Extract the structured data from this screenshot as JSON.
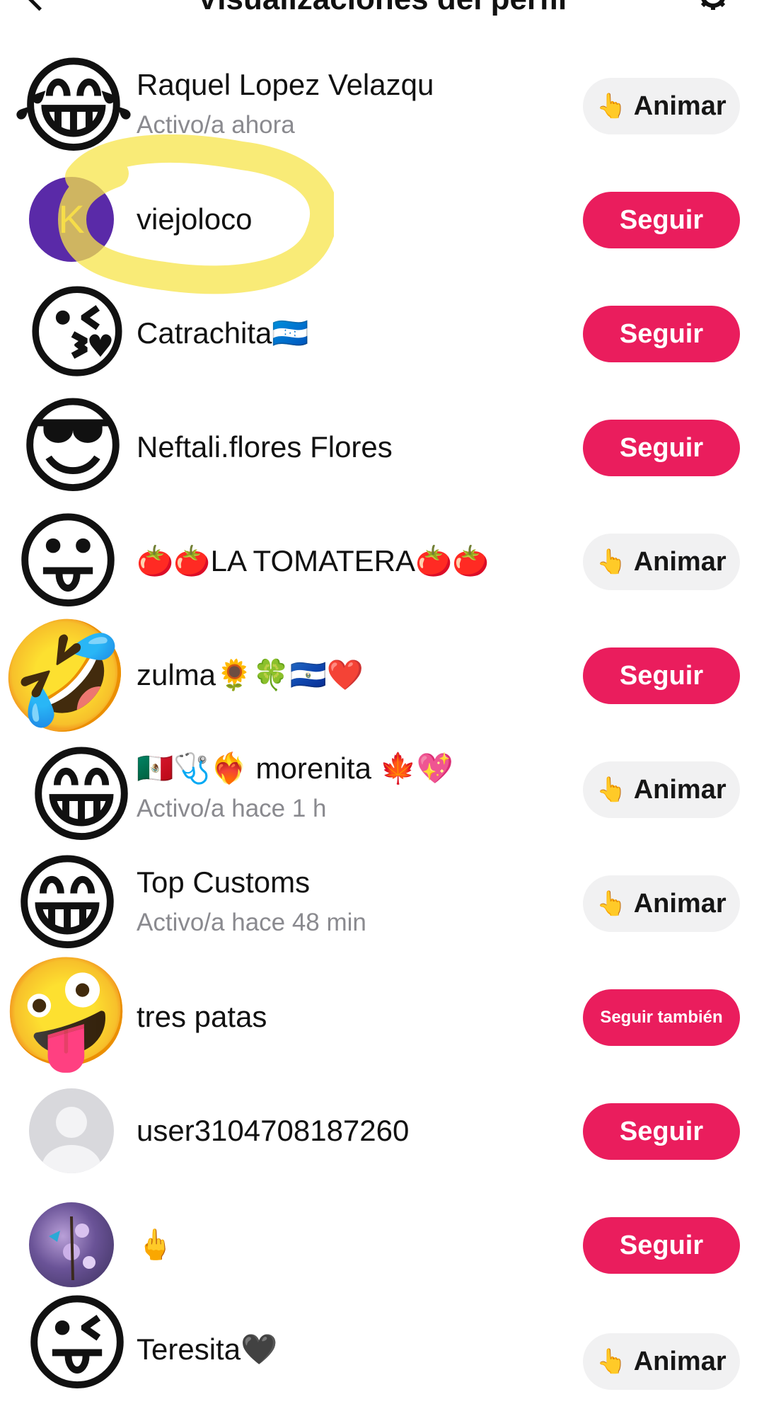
{
  "header": {
    "title": "Visualizaciones del perfil"
  },
  "rows": [
    {
      "name": "Raquel Lopez Velazqu",
      "status": "Activo/a ahora",
      "avatar": "😂",
      "button": "Animar",
      "button_icon": "👆"
    },
    {
      "name": "viejoloco",
      "avatar": "K",
      "button": "Seguir"
    },
    {
      "name": "Catrachita🇭🇳",
      "avatar": "😘",
      "button": "Seguir"
    },
    {
      "name": "Neftali.flores Flores",
      "avatar": "😎",
      "button": "Seguir"
    },
    {
      "name": "🍅🍅LA TOMATERA🍅🍅",
      "avatar": "😛",
      "button": "Animar",
      "button_icon": "👆"
    },
    {
      "name": "zulma🌻🍀🇸🇻❤️",
      "avatar": "🤣",
      "button": "Seguir"
    },
    {
      "name": "🇲🇽🩺❤️‍🔥 morenita 🍁💖",
      "status": "Activo/a hace 1 h",
      "avatar": "😁",
      "button": "Animar",
      "button_icon": "👆"
    },
    {
      "name": "Top Customs",
      "status": "Activo/a hace 48 min",
      "avatar": "😁",
      "button": "Animar",
      "button_icon": "👆"
    },
    {
      "name": "tres patas",
      "avatar": "🤪",
      "button": "Seguir también"
    },
    {
      "name": "user3104708187260",
      "avatar": "default",
      "button": "Seguir"
    },
    {
      "name": "🖕",
      "avatar": "photo",
      "button": "Seguir"
    },
    {
      "name": "Teresita🖤",
      "avatar": "😜",
      "button": "Animar",
      "button_icon": "👆"
    }
  ],
  "colors": {
    "follow_button": "#ea1d5d",
    "cheer_button": "#f1f1f2",
    "highlight": "#f7e44a"
  }
}
